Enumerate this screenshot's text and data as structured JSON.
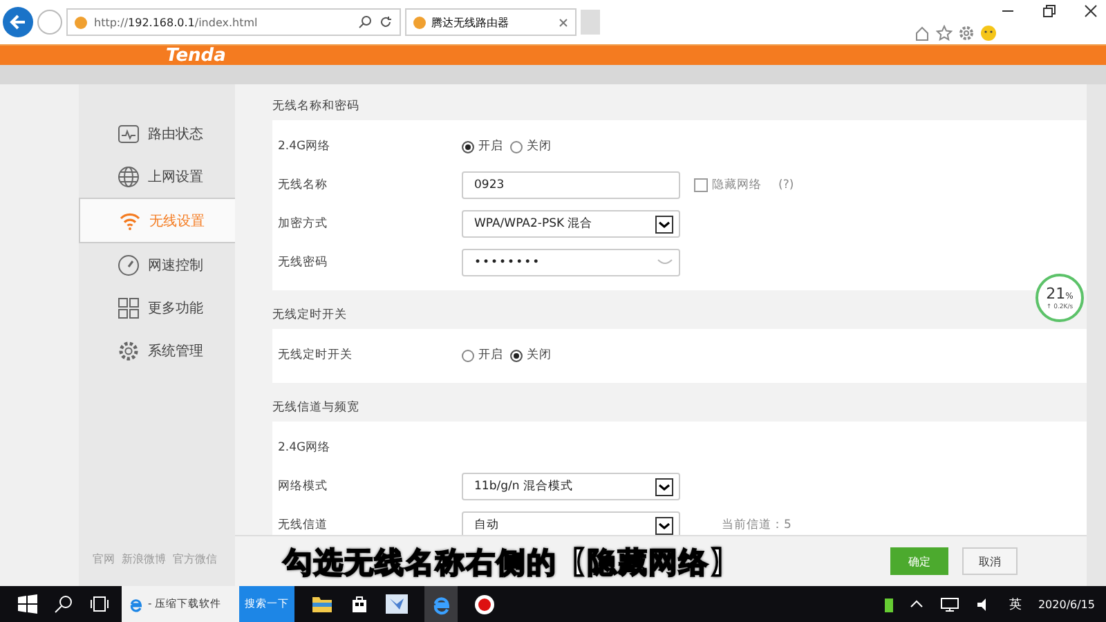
{
  "browser": {
    "url_prefix": "http://",
    "url_host": "192.168.0.1",
    "url_path": "/index.html",
    "tab_title": "腾达无线路由器"
  },
  "header": {
    "logo": "Tenda"
  },
  "sidebar": {
    "items": [
      {
        "label": "路由状态",
        "selected": false
      },
      {
        "label": "上网设置",
        "selected": false
      },
      {
        "label": "无线设置",
        "selected": true
      },
      {
        "label": "网速控制",
        "selected": false
      },
      {
        "label": "更多功能",
        "selected": false
      },
      {
        "label": "系统管理",
        "selected": false
      }
    ],
    "footer_links": [
      "官网",
      "新浪微博",
      "官方微信"
    ]
  },
  "sections": [
    {
      "title": "无线名称和密码",
      "rows": [
        {
          "kind": "radio",
          "label": "2.4G网络",
          "options": [
            {
              "label": "开启",
              "selected": true
            },
            {
              "label": "关闭",
              "selected": false
            }
          ]
        },
        {
          "kind": "text",
          "label": "无线名称",
          "value": "0923",
          "checkbox": {
            "label": "隐藏网络",
            "checked": false,
            "help": "(?)"
          }
        },
        {
          "kind": "select",
          "label": "加密方式",
          "value": "WPA/WPA2-PSK 混合"
        },
        {
          "kind": "password",
          "label": "无线密码",
          "value": "••••••••"
        }
      ]
    },
    {
      "title": "无线定时开关",
      "rows": [
        {
          "kind": "radio",
          "label": "无线定时开关",
          "options": [
            {
              "label": "开启",
              "selected": false
            },
            {
              "label": "关闭",
              "selected": true
            }
          ]
        }
      ]
    },
    {
      "title": "无线信道与频宽",
      "rows": [
        {
          "kind": "heading",
          "label": "2.4G网络"
        },
        {
          "kind": "select",
          "label": "网络模式",
          "value": "11b/g/n 混合模式"
        },
        {
          "kind": "select",
          "label": "无线信道",
          "value": "自动",
          "note": "当前信道：5"
        }
      ]
    }
  ],
  "buttons": [
    {
      "label": "确定",
      "kind": "primary"
    },
    {
      "label": "取消",
      "kind": "secondary"
    }
  ],
  "speed_widget": {
    "percent": "21",
    "unit": "%",
    "rate": "↑ 0.2K/s"
  },
  "caption": "勾选无线名称右侧的【隐藏网络】",
  "taskbar": {
    "search_text": "- 压缩下载软件",
    "search_button": "搜索一下",
    "ime": "英",
    "date": "2020/6/15"
  }
}
